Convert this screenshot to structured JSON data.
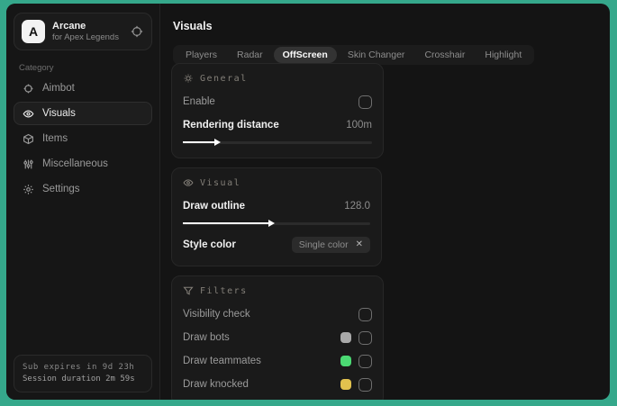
{
  "frame": {
    "background": "#35a88b",
    "window_background": "#141414"
  },
  "sidebar": {
    "brand": {
      "initial": "A",
      "title": "Arcane",
      "subtitle": "for Apex Legends",
      "action_icon": "crosshair-target-icon"
    },
    "category_label": "Category",
    "items": [
      {
        "label": "Aimbot",
        "icon": "crosshair-icon",
        "active": false
      },
      {
        "label": "Visuals",
        "icon": "eye-icon",
        "active": true
      },
      {
        "label": "Items",
        "icon": "cube-icon",
        "active": false
      },
      {
        "label": "Miscellaneous",
        "icon": "sliders-icon",
        "active": false
      },
      {
        "label": "Settings",
        "icon": "gear-icon",
        "active": false
      }
    ],
    "footer": {
      "line1": "Sub expires in 9d 23h",
      "line2": "Session duration 2m 59s"
    }
  },
  "main": {
    "title": "Visuals",
    "tabs": [
      {
        "label": "Players",
        "active": false
      },
      {
        "label": "Radar",
        "active": false
      },
      {
        "label": "OffScreen",
        "active": true
      },
      {
        "label": "Skin Changer",
        "active": false
      },
      {
        "label": "Crosshair",
        "active": false
      },
      {
        "label": "Highlight",
        "active": false
      }
    ],
    "panels": {
      "general": {
        "title": "General",
        "icon": "sun-gear-icon",
        "enable_label": "Enable",
        "enable_checked": false,
        "rendering_label": "Rendering distance",
        "rendering_value": "100m",
        "rendering_fill_percent": 19
      },
      "visual": {
        "title": "Visual",
        "icon": "eye-icon",
        "outline_label": "Draw outline",
        "outline_value": "128.0",
        "outline_fill_percent": 48,
        "style_label": "Style color",
        "style_tag": "Single color",
        "style_clear": "✕"
      },
      "filters": {
        "title": "Filters",
        "icon": "funnel-icon",
        "rows": [
          {
            "label": "Visibility check",
            "swatch": null,
            "checked": false
          },
          {
            "label": "Draw bots",
            "swatch": "#a9a9a9",
            "checked": false
          },
          {
            "label": "Draw teammates",
            "swatch": "#4bd973",
            "checked": false
          },
          {
            "label": "Draw knocked",
            "swatch": "#e2c24e",
            "checked": false
          }
        ]
      }
    }
  }
}
